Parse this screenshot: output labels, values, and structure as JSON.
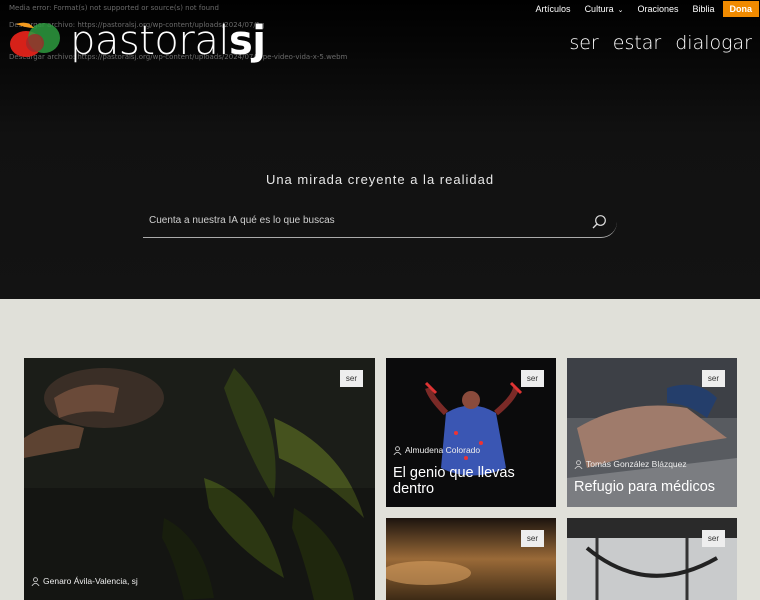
{
  "errors": {
    "media": "Media error: Format(s) not supported or source(s) not found",
    "download1": "Descargar archivo: https://pastoralsj.org/wp-content/uploads/2024/07/1-pe-video-vida-x-5-",
    "download2": "Descargar archivo: https://pastoralsj.org/wp-content/uploads/2024/07/1-pe-video-vida-x-5.webm"
  },
  "logo": {
    "text_light": "pastoral",
    "text_bold": "sj"
  },
  "topnav": {
    "articulos": "Artículos",
    "cultura": "Cultura",
    "oraciones": "Oraciones",
    "biblia": "Biblia",
    "dona": "Dona"
  },
  "mainnav": {
    "ser": "ser",
    "estar": "estar",
    "dialogar": "dialogar"
  },
  "hero": {
    "tagline": "Una mirada creyente a la realidad",
    "search_placeholder": "Cuenta a nuestra IA qué es lo que buscas"
  },
  "cards": [
    {
      "tag": "ser",
      "author": "Genaro Ávila-Valencia, sj",
      "title": ""
    },
    {
      "tag": "ser",
      "author": "Almudena Colorado",
      "title": "El genio que llevas dentro"
    },
    {
      "tag": "ser",
      "author": "Tomás González Blázquez",
      "title": "Refugio para médicos"
    },
    {
      "tag": "ser",
      "author": "",
      "title": ""
    },
    {
      "tag": "ser",
      "author": "",
      "title": ""
    }
  ]
}
